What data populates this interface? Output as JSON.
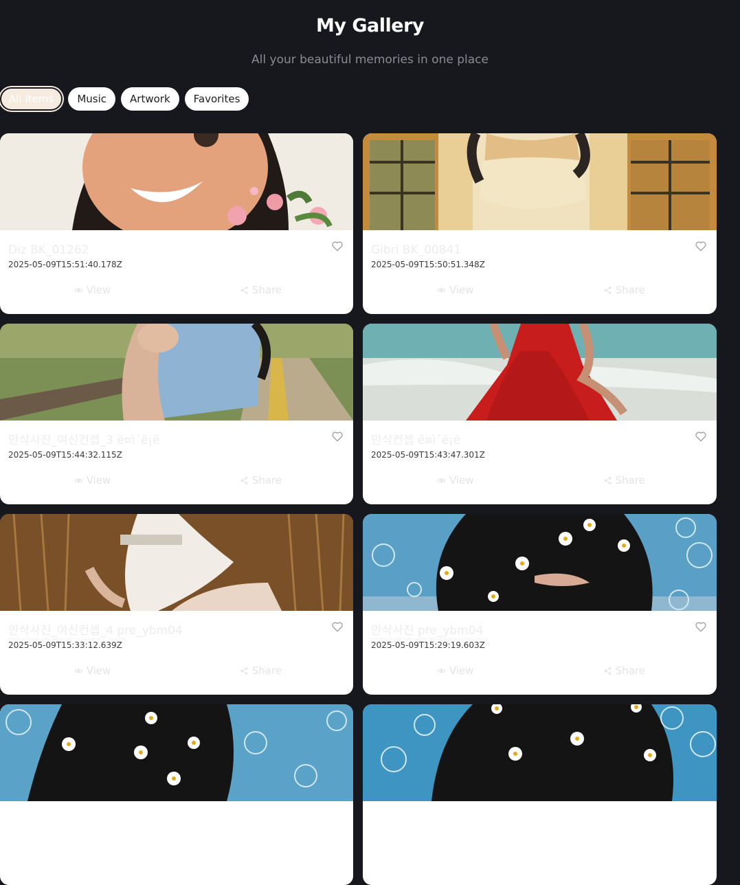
{
  "header": {
    "title": "My Gallery",
    "subtitle": "All your beautiful memories in one place"
  },
  "filters": [
    {
      "label": "All Items",
      "active": true
    },
    {
      "label": "Music",
      "active": false
    },
    {
      "label": "Artwork",
      "active": false
    },
    {
      "label": "Favorites",
      "active": false
    }
  ],
  "actions": {
    "view_label": "View",
    "share_label": "Share"
  },
  "items": [
    {
      "name": "Diz BK_01262",
      "date": "2025-05-09T15:51:40.178Z"
    },
    {
      "name": "Gibri BK_00841",
      "date": "2025-05-09T15:50:51.348Z"
    },
    {
      "name": "만삭사진_여신컨셉_3 ë¤ì´ë¡ë",
      "date": "2025-05-09T15:44:32.115Z"
    },
    {
      "name": "만삭컨셉 ë¤ì´ë¡ë",
      "date": "2025-05-09T15:43:47.301Z"
    },
    {
      "name": "만삭사진_여신컨셉_4 pre_ybm04",
      "date": "2025-05-09T15:33:12.639Z"
    },
    {
      "name": "만삭사진 pre_ybm04",
      "date": "2025-05-09T15:29:19.603Z"
    },
    {
      "name": "",
      "date": ""
    },
    {
      "name": "",
      "date": ""
    }
  ],
  "colors": {
    "background": "#17181d",
    "card": "#ffffff",
    "active_chip": "#f5ebdf"
  }
}
